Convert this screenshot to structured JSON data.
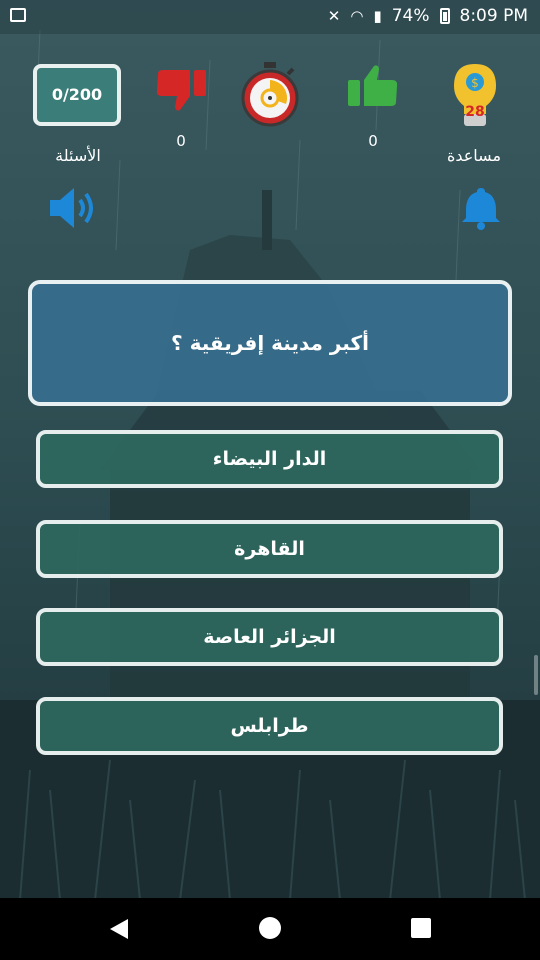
{
  "status_bar": {
    "battery": "74%",
    "time": "8:09 PM"
  },
  "stats": {
    "questions_counter": "0/200",
    "questions_label": "الأسئلة",
    "wrong_count": "0",
    "correct_count": "0",
    "help_count": "28",
    "help_label": "مساعدة"
  },
  "question": {
    "text": "أكبر مدينة إفريقية ؟"
  },
  "answers": [
    {
      "label": "الدار البيضاء"
    },
    {
      "label": "القاهرة"
    },
    {
      "label": "الجزائر العاصة"
    },
    {
      "label": "طرابلس"
    }
  ],
  "colors": {
    "counter_bg": "#3b7d79",
    "question_bg": "#387396",
    "answer_bg": "#2e685e",
    "thumb_up": "#3fb045",
    "thumb_down": "#d62727",
    "speaker": "#1e88d8",
    "bell": "#1e88d8"
  },
  "icons": [
    "thumbs-down-icon",
    "timer-icon",
    "thumbs-up-icon",
    "lightbulb-coin-icon",
    "speaker-icon",
    "bell-icon"
  ]
}
